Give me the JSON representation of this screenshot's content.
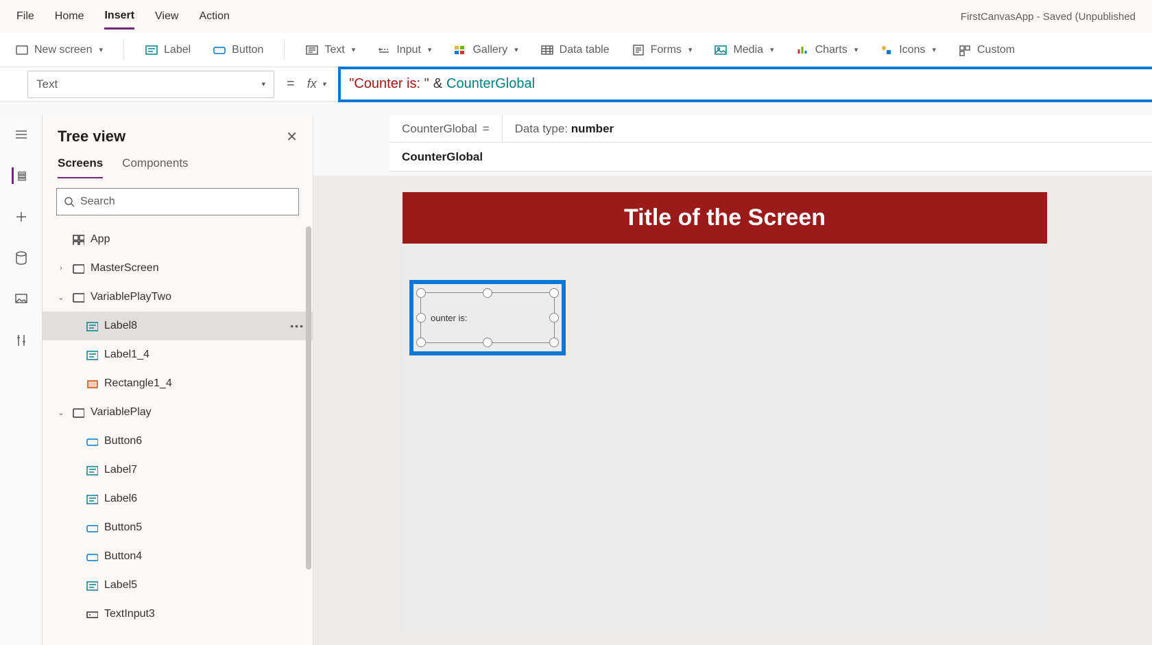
{
  "menubar": {
    "items": [
      "File",
      "Home",
      "Insert",
      "View",
      "Action"
    ],
    "active_index": 2,
    "app_title": "FirstCanvasApp - Saved (Unpublished"
  },
  "ribbon": {
    "new_screen": "New screen",
    "label": "Label",
    "button": "Button",
    "text": "Text",
    "input": "Input",
    "gallery": "Gallery",
    "data_table": "Data table",
    "forms": "Forms",
    "media": "Media",
    "charts": "Charts",
    "icons": "Icons",
    "custom": "Custom"
  },
  "property_selector": {
    "value": "Text"
  },
  "formula": {
    "string_part": "\"Counter is: \"",
    "op": "&",
    "var_part": "CounterGlobal"
  },
  "info": {
    "equals_left": "CounterGlobal",
    "equals_sign": "=",
    "data_type_label": "Data type:",
    "data_type_value": "number",
    "suggest": "CounterGlobal"
  },
  "tree_panel": {
    "title": "Tree view",
    "tabs": [
      "Screens",
      "Components"
    ],
    "active_tab": 0,
    "search_placeholder": "Search",
    "items": [
      {
        "name": "App",
        "depth": 0,
        "icon": "app",
        "expander": ""
      },
      {
        "name": "MasterScreen",
        "depth": 0,
        "icon": "screen",
        "expander": "›"
      },
      {
        "name": "VariablePlayTwo",
        "depth": 0,
        "icon": "screen",
        "expander": "⌄"
      },
      {
        "name": "Label8",
        "depth": 1,
        "icon": "label",
        "selected": true,
        "more": true
      },
      {
        "name": "Label1_4",
        "depth": 1,
        "icon": "label"
      },
      {
        "name": "Rectangle1_4",
        "depth": 1,
        "icon": "rect"
      },
      {
        "name": "VariablePlay",
        "depth": 0,
        "icon": "screen",
        "expander": "⌄"
      },
      {
        "name": "Button6",
        "depth": 1,
        "icon": "button"
      },
      {
        "name": "Label7",
        "depth": 1,
        "icon": "label"
      },
      {
        "name": "Label6",
        "depth": 1,
        "icon": "label"
      },
      {
        "name": "Button5",
        "depth": 1,
        "icon": "button"
      },
      {
        "name": "Button4",
        "depth": 1,
        "icon": "button"
      },
      {
        "name": "Label5",
        "depth": 1,
        "icon": "label"
      },
      {
        "name": "TextInput3",
        "depth": 1,
        "icon": "textinput"
      }
    ]
  },
  "canvas": {
    "screen_title": "Title of the Screen",
    "selected_label_text": "ounter is:"
  },
  "leftrail": {
    "items": [
      "hamburger",
      "layers",
      "plus",
      "data",
      "media-tree",
      "advanced"
    ]
  }
}
